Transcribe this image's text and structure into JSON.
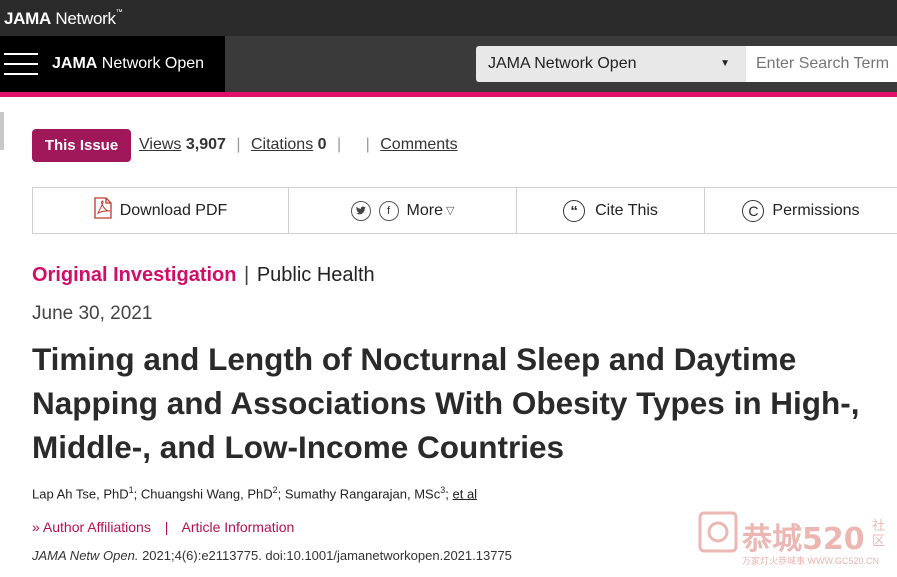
{
  "network": {
    "brand_bold": "JAMA",
    "brand_rest": " Network",
    "tm": "™"
  },
  "journal_bar": {
    "title_bold": "JAMA",
    "title_rest": " Network Open",
    "select_value": "JAMA Network Open",
    "search_placeholder": "Enter Search Term"
  },
  "issue": {
    "button": "This Issue",
    "views_label": "Views",
    "views_count": "3,907",
    "citations_label": "Citations",
    "citations_count": "0",
    "comments_label": "Comments"
  },
  "toolbar": {
    "download": "Download PDF",
    "twitter_icon": "twitter-icon",
    "facebook_icon": "facebook-icon",
    "more": "More",
    "cite": "Cite This",
    "permissions": "Permissions"
  },
  "article": {
    "type": "Original Investigation",
    "separator": "|",
    "subject": "Public Health",
    "date": "June 30, 2021",
    "title_lines": [
      "Timing and Length of Nocturnal Sleep and Daytime",
      "Napping and Associations With Obesity Types in High-,",
      "Middle-, and Low-Income Countries"
    ],
    "authors": [
      {
        "name": "Lap Ah Tse, PhD",
        "sup": "1"
      },
      {
        "name": "Chuangshi Wang, PhD",
        "sup": "2"
      },
      {
        "name": "Sumathy Rangarajan, MSc",
        "sup": "3"
      }
    ],
    "et_al": "et al",
    "author_affiliations": "Author Affiliations",
    "article_information": "Article Information",
    "citation_journal": "JAMA Netw Open.",
    "citation_rest": " 2021;4(6):e2113775. doi:10.1001/jamanetworkopen.2021.13775"
  },
  "watermark": {
    "text": "恭城520",
    "side": "社区",
    "url": "万家灯火恭城事 WWW.GC520.CN"
  },
  "colors": {
    "accent": "#e0116b",
    "issue_button": "#a0175a",
    "link": "#b5114f"
  }
}
